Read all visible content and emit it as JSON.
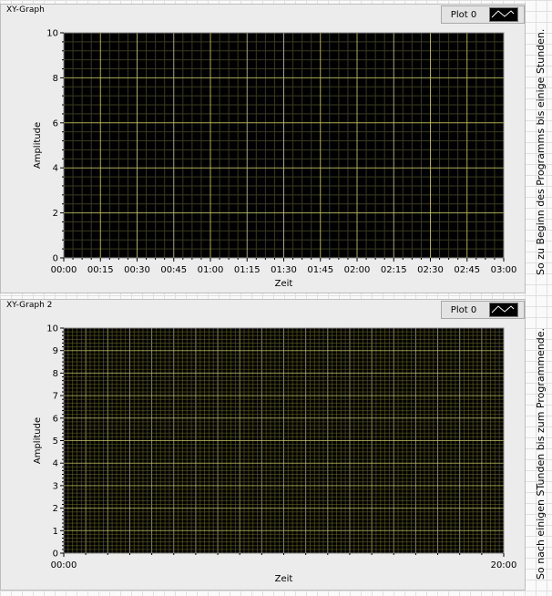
{
  "graphs": [
    {
      "label": "XY-Graph",
      "legend": {
        "name": "Plot 0"
      },
      "ylabel": "Amplitude",
      "xlabel": "Zeit",
      "y_ticks": [
        "0",
        "2",
        "4",
        "6",
        "8",
        "10"
      ],
      "x_ticks": [
        "00:00",
        "00:15",
        "00:30",
        "00:45",
        "01:00",
        "01:15",
        "01:30",
        "01:45",
        "02:00",
        "02:15",
        "02:30",
        "02:45",
        "03:00"
      ]
    },
    {
      "label": "XY-Graph 2",
      "legend": {
        "name": "Plot 0"
      },
      "ylabel": "Amplitude",
      "xlabel": "Zeit",
      "y_ticks": [
        "0",
        "1",
        "2",
        "3",
        "4",
        "5",
        "6",
        "7",
        "8",
        "9",
        "10"
      ],
      "x_ticks": [
        "00:00",
        "20:00"
      ]
    }
  ],
  "notes": {
    "top": "So zu Beginn des Programms bis einige Stunden.",
    "bottom": "So nach einigen STunden bis zum Programmende."
  },
  "colors": {
    "plot_bg": "#000000",
    "major_grid": "#c8c864",
    "minor_grid": "#3a3a1e",
    "dense_grid": "#6b6b2e"
  },
  "chart_data": [
    {
      "type": "line",
      "title": "XY-Graph",
      "xlabel": "Zeit",
      "ylabel": "Amplitude",
      "xlim": [
        "00:00",
        "03:00"
      ],
      "ylim": [
        0,
        10
      ],
      "series": [
        {
          "name": "Plot 0",
          "x": [],
          "y": []
        }
      ],
      "grid": true
    },
    {
      "type": "line",
      "title": "XY-Graph 2",
      "xlabel": "Zeit",
      "ylabel": "Amplitude",
      "xlim": [
        "00:00",
        "20:00"
      ],
      "ylim": [
        0,
        10
      ],
      "series": [
        {
          "name": "Plot 0",
          "x": [],
          "y": []
        }
      ],
      "grid": true
    }
  ]
}
